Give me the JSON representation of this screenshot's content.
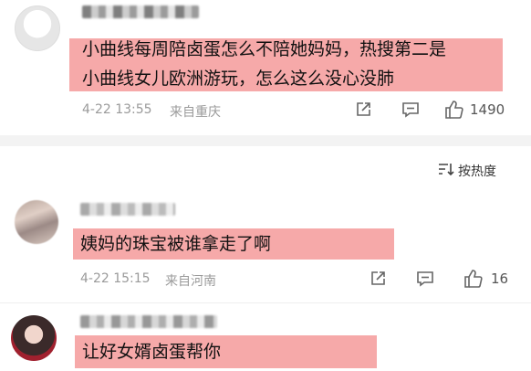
{
  "comments": [
    {
      "lines": [
        "小曲线每周陪卤蛋怎么不陪她妈妈，热搜第二是",
        "小曲线女儿欧洲游玩，怎么这么没心没肺"
      ],
      "time": "4-22 13:55",
      "location": "来自重庆",
      "like_count": "1490"
    },
    {
      "lines": [
        "姨妈的珠宝被谁拿走了啊"
      ],
      "time": "4-22 15:15",
      "location": "来自河南",
      "like_count": "16"
    },
    {
      "lines": [
        "让好女婿卤蛋帮你"
      ]
    }
  ],
  "sort": {
    "label": "按热度"
  },
  "icons": {
    "share": "share-icon",
    "comment": "comment-icon",
    "like": "thumbs-up-icon",
    "sort": "sort-icon"
  },
  "colors": {
    "highlight": "#f6a9a9",
    "meta": "#9a9a9a",
    "separator": "#f3f3f3"
  }
}
